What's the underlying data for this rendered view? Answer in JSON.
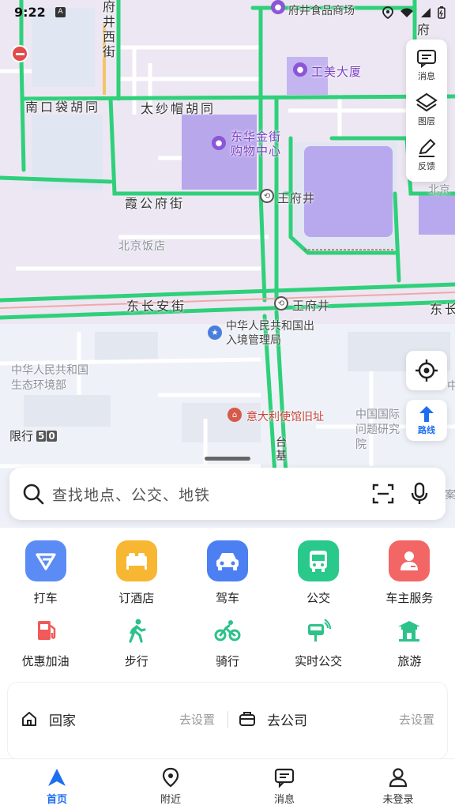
{
  "status_bar": {
    "time": "9:22",
    "badge": "A"
  },
  "map": {
    "labels": {
      "fujing_xi": "府井西街",
      "fujing_top": "府井食品商场",
      "gongmei": "工美大厦",
      "nankou": "南口袋胡同",
      "taijia": "太纱帽胡同",
      "dongfang": "东华金街购物中心",
      "xiagong": "霞公府街",
      "wfj_station1": "王府井",
      "beijing_fandian": "北京饭店",
      "beijing_right": "北京",
      "dongchangan": "东长安街",
      "wfj_station2": "王府井",
      "dongchang_right": "东长",
      "exit_entry": "中华人民共和国出入境管理局",
      "ecology": "中华人民共和国生态环境部",
      "italy": "意大利使馆旧址",
      "china_research": "中国国际问题研究院",
      "taiji": "台基",
      "right_edge": "中",
      "top_right_fu": "府",
      "bottom_right": "案"
    },
    "limit_label": "限行",
    "limit_nums": [
      "5",
      "0"
    ]
  },
  "tools": {
    "messages": "消息",
    "layers": "图层",
    "feedback": "反馈",
    "route": "路线"
  },
  "search": {
    "placeholder": "查找地点、公交、地铁"
  },
  "services_row1": [
    {
      "label": "打车",
      "color": "#5b8cf6",
      "icon": "taxi-icon"
    },
    {
      "label": "订酒店",
      "color": "#f8b732",
      "icon": "hotel-icon"
    },
    {
      "label": "驾车",
      "color": "#4c7ff2",
      "icon": "car-icon"
    },
    {
      "label": "公交",
      "color": "#28c98a",
      "icon": "bus-icon"
    },
    {
      "label": "车主服务",
      "color": "#f26666",
      "icon": "owner-icon"
    }
  ],
  "services_row2": [
    {
      "label": "优惠加油",
      "color": "#f05a5a",
      "icon": "fuel-icon"
    },
    {
      "label": "步行",
      "color": "#2cc28a",
      "icon": "walk-icon"
    },
    {
      "label": "骑行",
      "color": "#2cc28a",
      "icon": "bike-icon"
    },
    {
      "label": "实时公交",
      "color": "#2cc28a",
      "icon": "realtime-bus-icon"
    },
    {
      "label": "旅游",
      "color": "#2cc28a",
      "icon": "travel-icon"
    }
  ],
  "shortcuts": {
    "home": {
      "name": "回家",
      "action": "去设置"
    },
    "work": {
      "name": "去公司",
      "action": "去设置"
    }
  },
  "bottom_nav": [
    {
      "label": "首页",
      "active": true
    },
    {
      "label": "附近",
      "active": false
    },
    {
      "label": "消息",
      "active": false
    },
    {
      "label": "未登录",
      "active": false
    }
  ],
  "colors": {
    "accent": "#1d6ff2",
    "road": "#2fd07a"
  }
}
